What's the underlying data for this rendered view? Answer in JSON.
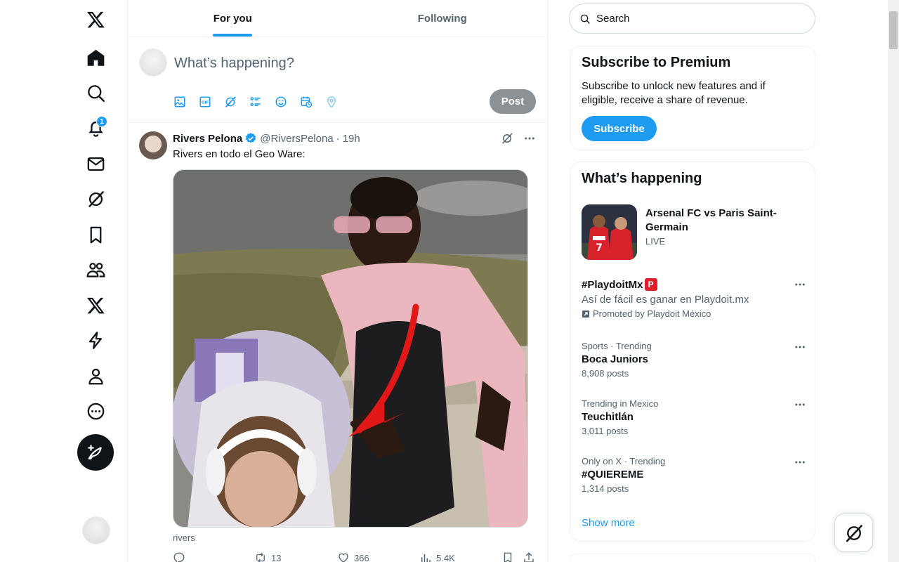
{
  "nav": {
    "items": [
      {
        "name": "x-logo",
        "icon": "x-logo-icon"
      },
      {
        "name": "home",
        "icon": "home-icon"
      },
      {
        "name": "explore",
        "icon": "search-icon"
      },
      {
        "name": "notifications",
        "icon": "bell-icon",
        "badge": "1"
      },
      {
        "name": "messages",
        "icon": "mail-icon"
      },
      {
        "name": "grok",
        "icon": "grok-icon"
      },
      {
        "name": "bookmarks",
        "icon": "bookmark-icon"
      },
      {
        "name": "communities",
        "icon": "people-icon"
      },
      {
        "name": "premium",
        "icon": "x-logo-icon"
      },
      {
        "name": "verified-orgs",
        "icon": "lightning-icon"
      },
      {
        "name": "profile",
        "icon": "person-icon"
      },
      {
        "name": "more",
        "icon": "more-circle-icon"
      }
    ]
  },
  "tabs": {
    "for_you": "For you",
    "following": "Following"
  },
  "composer": {
    "placeholder": "What’s happening?",
    "post_label": "Post"
  },
  "tweet": {
    "name": "Rivers Pelona",
    "handle": "@RiversPelona",
    "separator": "·",
    "time": "19h",
    "text": "Rivers en todo el Geo Ware:",
    "caption": "rivers",
    "replies": "",
    "reposts": "13",
    "likes": "366",
    "views": "5.4K"
  },
  "search": {
    "placeholder": "Search"
  },
  "premium": {
    "title": "Subscribe to Premium",
    "body": "Subscribe to unlock new features and if eligible, receive a share of revenue.",
    "button": "Subscribe"
  },
  "happening": {
    "title": "What’s happening",
    "feature": {
      "title": "Arsenal FC vs Paris Saint-Germain",
      "status": "LIVE"
    },
    "promo": {
      "name": "#PlaydoitMx",
      "desc": "Así de fácil es ganar en Playdoit.mx",
      "by": "Promoted by Playdoit México"
    },
    "trends": [
      {
        "meta": "Sports · Trending",
        "name": "Boca Juniors",
        "count": "8,908 posts"
      },
      {
        "meta": "Trending in Mexico",
        "name": "Teuchitlán",
        "count": "3,011 posts"
      },
      {
        "meta": "Only on X · Trending",
        "name": "#QUIEREME",
        "count": "1,314 posts"
      }
    ],
    "show_more": "Show more"
  },
  "colors": {
    "accent": "#1d9bf0",
    "text": "#0f1419",
    "muted": "#536471",
    "border": "#eff3f4"
  }
}
